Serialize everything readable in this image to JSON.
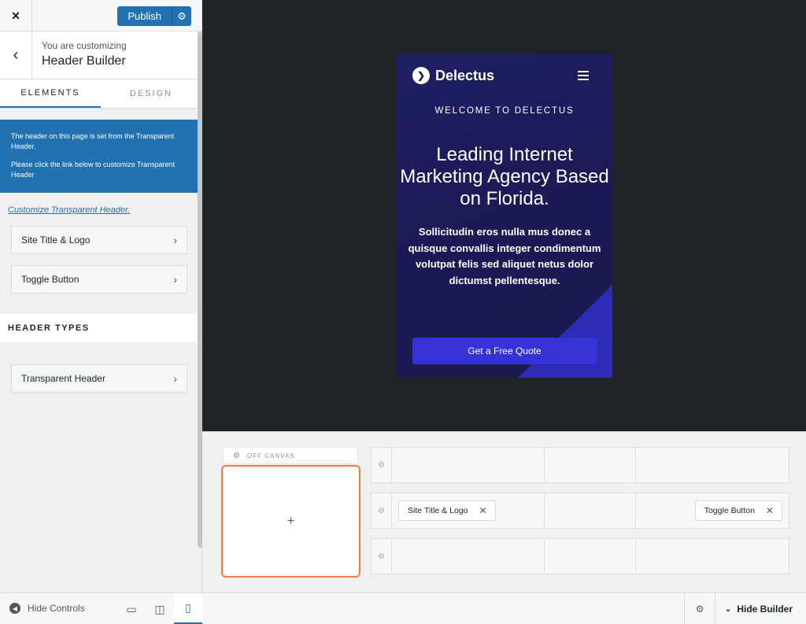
{
  "sidebar": {
    "close_icon": "×",
    "publish_label": "Publish",
    "gear_icon": "⚙",
    "back_icon": "‹",
    "crumb_pre": "You are customizing",
    "crumb_title": "Header Builder",
    "tabs": [
      {
        "label": "ELEMENTS",
        "active": true
      },
      {
        "label": "DESIGN",
        "active": false
      }
    ],
    "notice": {
      "line1": "The header on this page is set from the Transparent Header.",
      "line2": "Please click the link below to customize Transparent Header"
    },
    "customize_link": "Customize Transparent Header.",
    "items": [
      {
        "label": "Site Title & Logo"
      },
      {
        "label": "Toggle Button"
      }
    ],
    "chevron_icon": "›",
    "header_types_label": "HEADER TYPES",
    "header_types_items": [
      {
        "label": "Transparent Header"
      }
    ],
    "hide_controls_label": "Hide Controls",
    "hide_controls_icon": "◀",
    "devices": [
      "desktop-icon",
      "tablet-icon",
      "mobile-icon"
    ],
    "active_device": "mobile",
    "desktop_glyph": "▭",
    "tablet_glyph": "◫",
    "mobile_glyph": "▯"
  },
  "preview": {
    "logo_text": "Delectus",
    "logo_glyph": "❯",
    "welcome": "WELCOME TO DELECTUS",
    "headline": "Leading Internet Marketing Agency Based on Florida.",
    "body": "Sollicitudin eros nulla mus donec a quisque convallis integer condimentum volutpat felis sed aliquet netus dolor dictumst pellentesque.",
    "cta": "Get a Free Quote"
  },
  "builder": {
    "off_canvas_label": "OFF CANVAS",
    "add_icon": "+",
    "remove_icon": "✕",
    "rows": [
      {
        "chips_left": [],
        "chips_right": []
      },
      {
        "chips_left": [
          "Site Title & Logo"
        ],
        "chips_right": [
          "Toggle Button"
        ]
      },
      {
        "chips_left": [],
        "chips_right": []
      }
    ],
    "hide_builder_label": "Hide Builder",
    "collapse_icon": "⌄"
  },
  "colors": {
    "accent": "#2271b1",
    "offcanvas_border": "#f07c4a",
    "preview_bg": "#1d2327",
    "hero_bg": "#1e1f63",
    "cta_bg": "#3532d6"
  }
}
